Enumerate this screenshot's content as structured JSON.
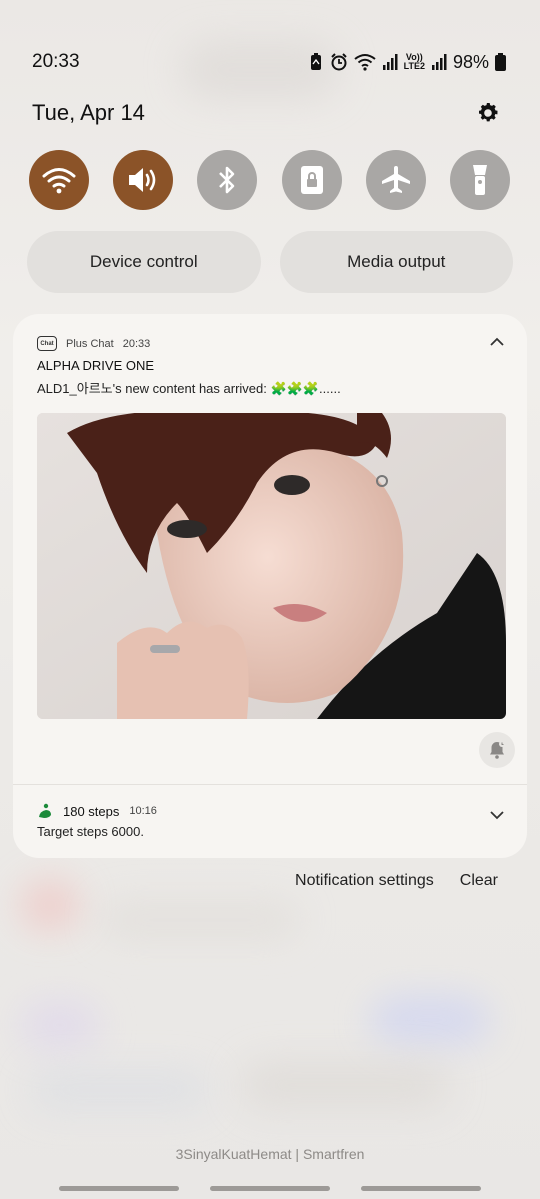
{
  "status_bar": {
    "time": "20:33",
    "battery_percent": "98%",
    "network_label_top": "Vo))",
    "network_label_bottom": "LTE2",
    "icons": [
      "recycle-icon",
      "alarm-icon",
      "wifi-icon",
      "signal-icon",
      "signal-icon",
      "battery-icon"
    ]
  },
  "header": {
    "date": "Tue, Apr 14",
    "settings_icon": "gear-icon"
  },
  "quick_settings": [
    {
      "name": "wifi",
      "icon": "wifi-icon",
      "state": "on"
    },
    {
      "name": "sound",
      "icon": "speaker-icon",
      "state": "on"
    },
    {
      "name": "bluetooth",
      "icon": "bluetooth-icon",
      "state": "off"
    },
    {
      "name": "screen-lock",
      "icon": "lock-icon",
      "state": "off"
    },
    {
      "name": "airplane",
      "icon": "airplane-icon",
      "state": "off"
    },
    {
      "name": "flashlight",
      "icon": "flashlight-icon",
      "state": "off"
    }
  ],
  "pills": {
    "device_control": "Device control",
    "media_output": "Media output"
  },
  "notification_chat": {
    "app_icon_text": "Chat",
    "app_name": "Plus Chat",
    "time": "20:33",
    "title": "ALPHA DRIVE ONE",
    "text": "ALD1_아르노's new content has arrived: 🧩🧩🧩......"
  },
  "notification_steps": {
    "title": "180 steps",
    "time": "10:16",
    "text": "Target steps 6000."
  },
  "actions": {
    "notification_settings": "Notification settings",
    "clear": "Clear"
  },
  "carrier": "3SinyalKuatHemat | Smartfren",
  "colors": {
    "toggle_on": "#8b5328",
    "toggle_off": "#a9a7a5"
  }
}
